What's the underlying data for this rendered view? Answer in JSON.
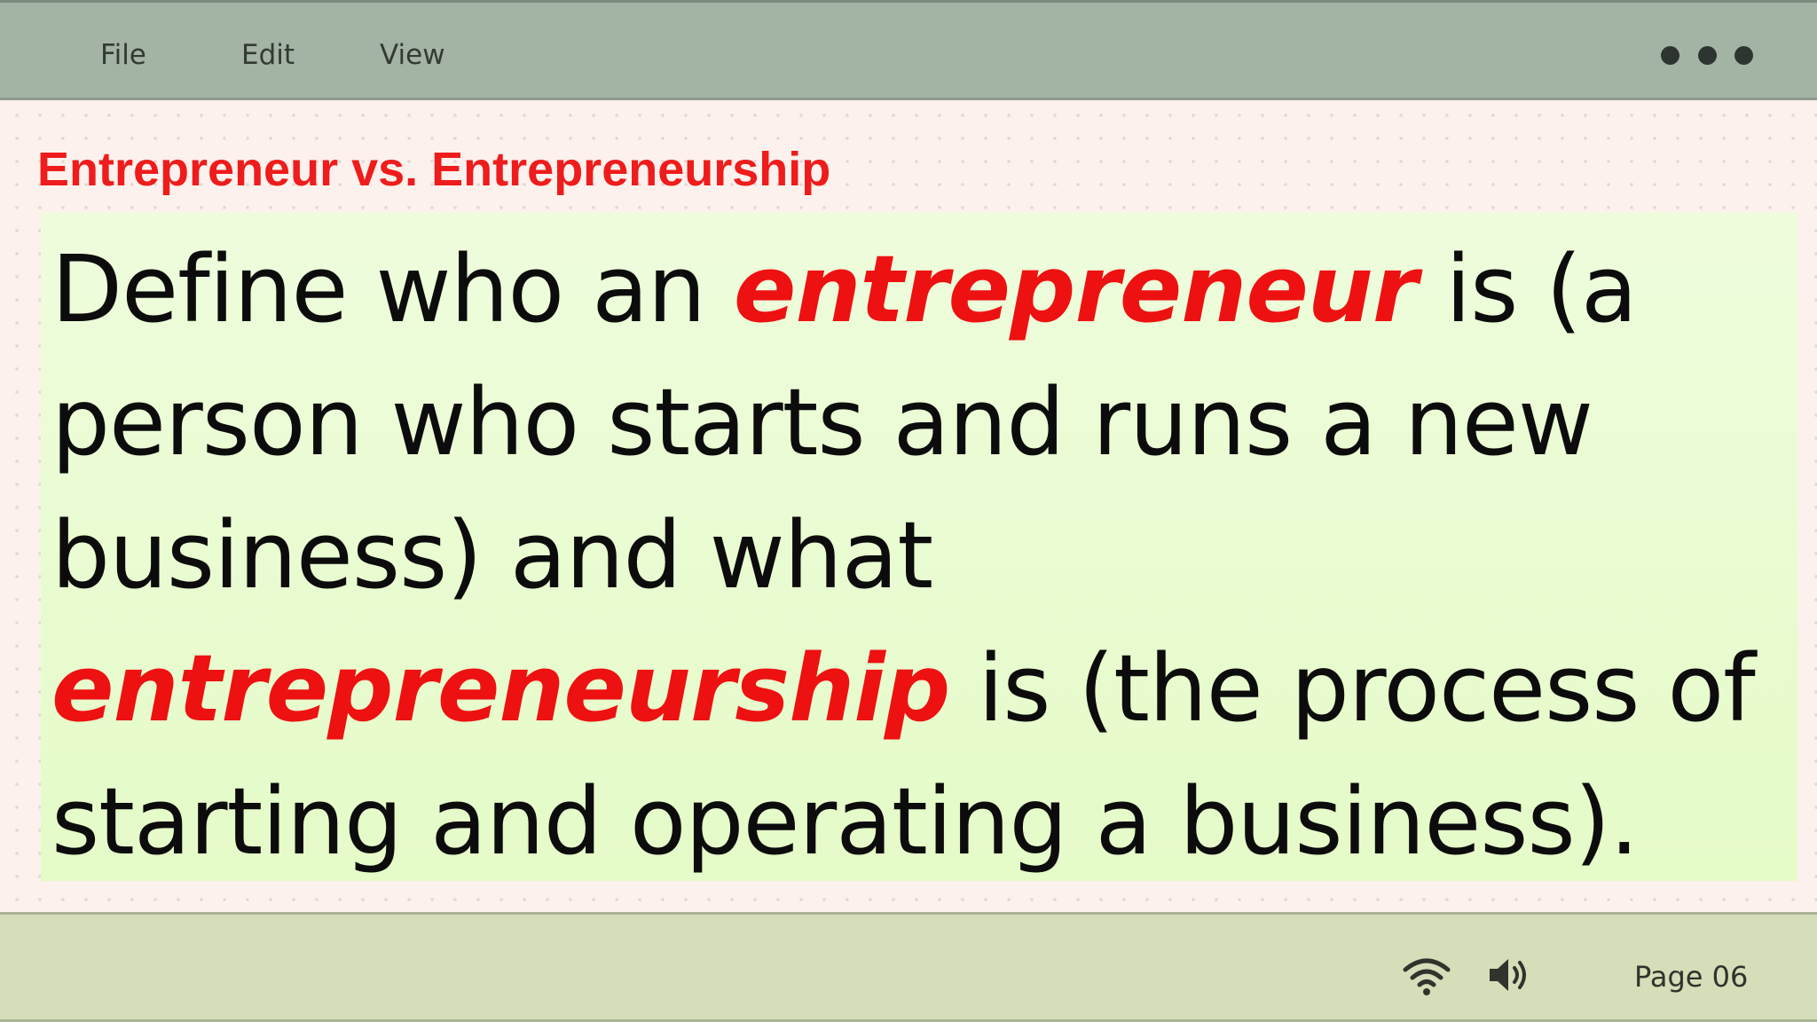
{
  "menu": {
    "items": [
      {
        "label": "File"
      },
      {
        "label": "Edit"
      },
      {
        "label": "View"
      }
    ],
    "more_icon": "more-horizontal-icon"
  },
  "slide": {
    "title": "Entrepreneur vs. Entrepreneurship",
    "body": {
      "segment_1": "Define who an ",
      "term_1": "entrepreneur",
      "segment_2": " is (a person who starts and runs a new business) and what ",
      "term_2": "entrepreneurship",
      "segment_3": " is (the process of starting and operating a business)."
    }
  },
  "status": {
    "wifi_icon": "wifi-icon",
    "speaker_icon": "speaker-volume-icon",
    "page_label": "Page 06"
  },
  "colors": {
    "menubar_bg": "#a3b3a4",
    "statusbar_bg": "#d5deb8",
    "slide_bg": "#fcf1ec",
    "content_bg": "#e5fbc8",
    "accent_red": "#ee1c1c",
    "body_text": "#0c0c0c"
  }
}
